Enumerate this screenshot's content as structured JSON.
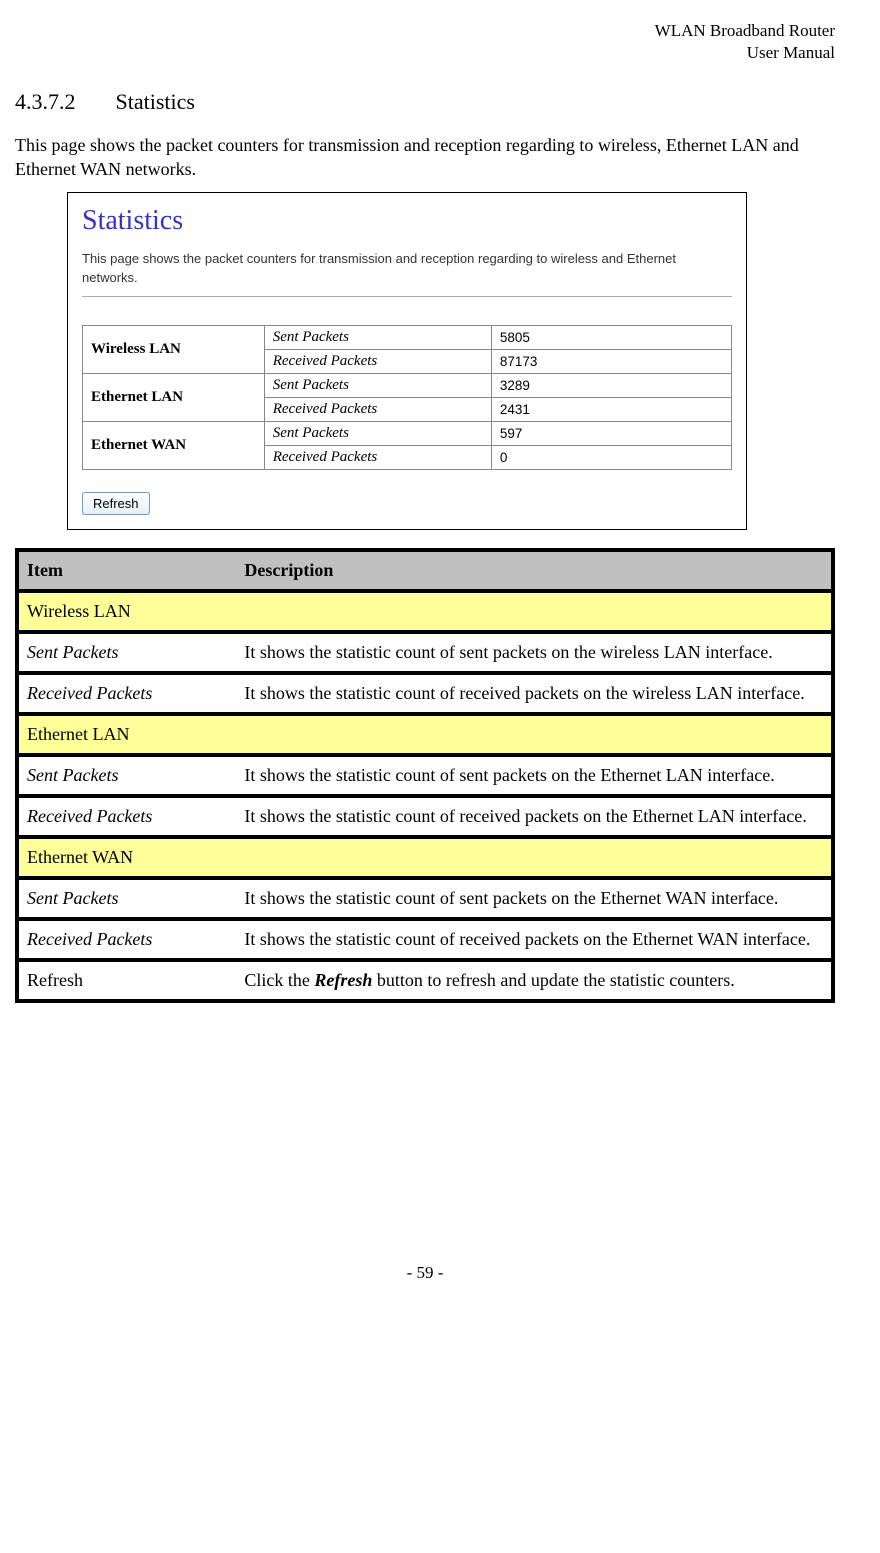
{
  "header": {
    "line1": "WLAN  Broadband  Router",
    "line2": "User  Manual"
  },
  "section": {
    "number": "4.3.7.2",
    "title": "Statistics"
  },
  "intro": "This page shows the packet counters for transmission and reception regarding to wireless, Ethernet LAN and Ethernet WAN networks.",
  "screenshot": {
    "title": "Statistics",
    "desc": "This page shows the packet counters for transmission and reception regarding to wireless and Ethernet networks.",
    "interfaces": [
      {
        "name": "Wireless LAN",
        "sent_label": "Sent Packets",
        "sent": "5805",
        "recv_label": "Received Packets",
        "recv": "87173"
      },
      {
        "name": "Ethernet LAN",
        "sent_label": "Sent Packets",
        "sent": "3289",
        "recv_label": "Received Packets",
        "recv": "2431"
      },
      {
        "name": "Ethernet WAN",
        "sent_label": "Sent Packets",
        "sent": "597",
        "recv_label": "Received Packets",
        "recv": "0"
      }
    ],
    "refresh_label": "Refresh"
  },
  "desc_table": {
    "headers": {
      "item": "Item",
      "description": "Description"
    },
    "sections": [
      {
        "title": "Wireless LAN",
        "rows": [
          {
            "item": "Sent Packets",
            "italic": true,
            "desc": "It shows the statistic count of sent packets on the wireless LAN interface."
          },
          {
            "item": "Received Packets",
            "italic": true,
            "desc": "It shows the statistic count of received packets on the wireless LAN interface."
          }
        ]
      },
      {
        "title": "Ethernet LAN",
        "rows": [
          {
            "item": "Sent Packets",
            "italic": true,
            "desc": "It shows the statistic count of sent packets on the Ethernet LAN interface."
          },
          {
            "item": "Received Packets",
            "italic": true,
            "desc": "It shows the statistic count of received packets on the Ethernet LAN interface."
          }
        ]
      },
      {
        "title": "Ethernet WAN",
        "rows": [
          {
            "item": "Sent Packets",
            "italic": true,
            "desc": "It shows the statistic count of sent packets on the Ethernet WAN interface."
          },
          {
            "item": "Received Packets",
            "italic": true,
            "desc": "It shows the statistic count of received packets on the Ethernet WAN interface."
          }
        ]
      }
    ],
    "extra_row": {
      "item": "Refresh",
      "desc_pre": "Click the ",
      "desc_bold": "Refresh",
      "desc_post": " button to refresh and update the statistic counters."
    }
  },
  "footer": "- 59 -"
}
